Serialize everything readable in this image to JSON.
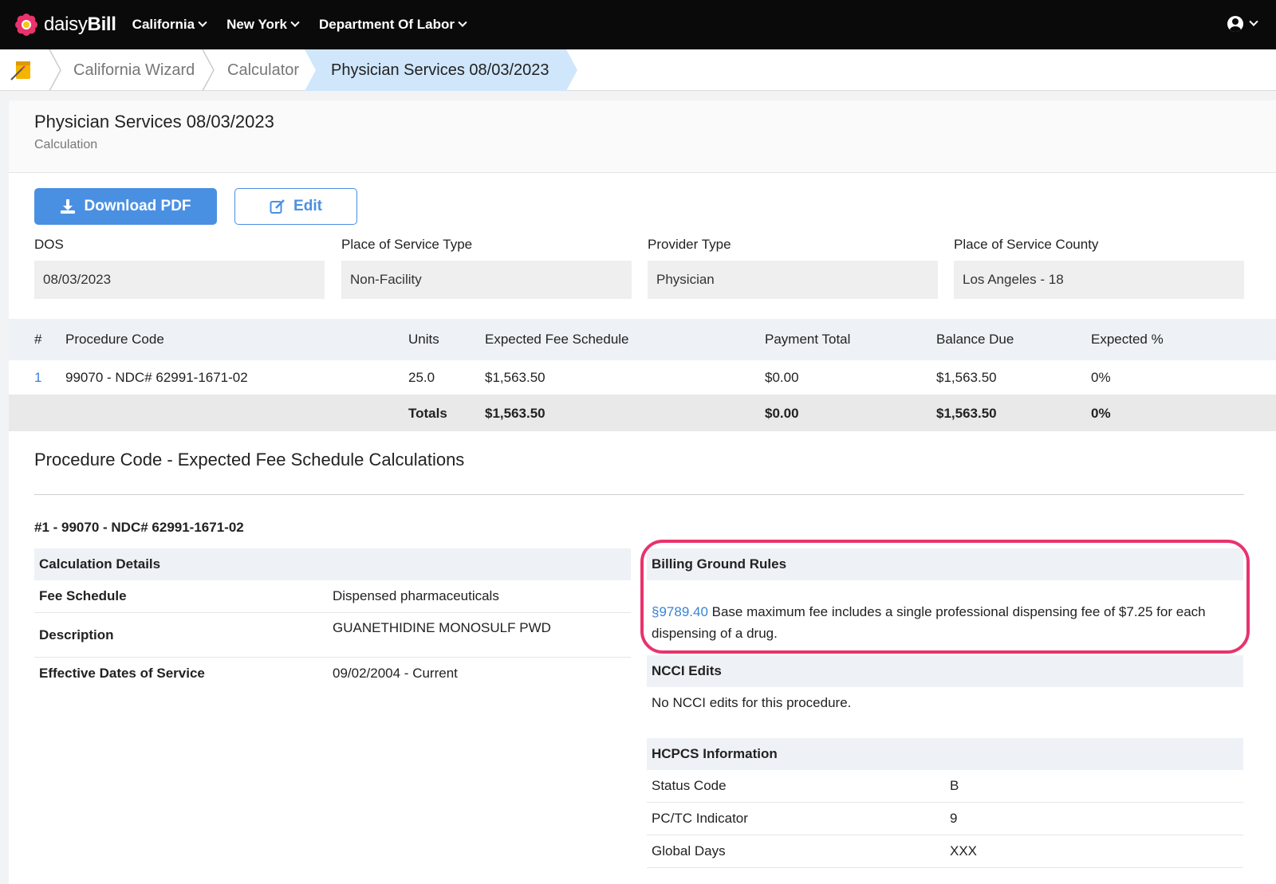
{
  "brand": {
    "name_light": "daisy",
    "name_bold": "Bill",
    "flower_color": "#e8336d"
  },
  "nav": {
    "items": [
      "California",
      "New York",
      "Department Of Labor"
    ]
  },
  "breadcrumb": {
    "items": [
      "California Wizard",
      "Calculator"
    ],
    "active": "Physician Services 08/03/2023"
  },
  "header": {
    "title": "Physician Services 08/03/2023",
    "subtitle": "Calculation"
  },
  "actions": {
    "download_label": "Download PDF",
    "edit_label": "Edit",
    "accent": "#4a90e2"
  },
  "fields": [
    {
      "label": "DOS",
      "value": "08/03/2023"
    },
    {
      "label": "Place of Service Type",
      "value": "Non-Facility"
    },
    {
      "label": "Provider Type",
      "value": "Physician"
    },
    {
      "label": "Place of Service County",
      "value": "Los Angeles - 18"
    }
  ],
  "table": {
    "headers": [
      "#",
      "Procedure Code",
      "Units",
      "Expected Fee Schedule",
      "Payment Total",
      "Balance Due",
      "Expected %"
    ],
    "rows": [
      {
        "num": "1",
        "code": "99070 - NDC# 62991-1671-02",
        "units": "25.0",
        "expected": "$1,563.50",
        "payment": "$0.00",
        "balance": "$1,563.50",
        "pct": "0%"
      }
    ],
    "totals": {
      "label": "Totals",
      "expected": "$1,563.50",
      "payment": "$0.00",
      "balance": "$1,563.50",
      "pct": "0%"
    }
  },
  "section": {
    "title": "Procedure Code - Expected Fee Schedule Calculations",
    "proc_title": "#1 - 99070 - NDC# 62991-1671-02"
  },
  "calc_details": {
    "title": "Calculation Details",
    "rows": [
      {
        "key": "Fee Schedule",
        "value": "Dispensed pharmaceuticals"
      },
      {
        "key": "Description",
        "value": "GUANETHIDINE MONOSULF PWD"
      },
      {
        "key": "Effective Dates of Service",
        "value": "09/02/2004 - Current"
      }
    ]
  },
  "billing_rules": {
    "title": "Billing Ground Rules",
    "link": "§9789.40",
    "text": " Base maximum fee includes a single professional dispensing fee of $7.25 for each dispensing of a drug.",
    "highlight_color": "#e8336d"
  },
  "ncci": {
    "title": "NCCI Edits",
    "text": "No NCCI edits for this procedure."
  },
  "hcpcs": {
    "title": "HCPCS Information",
    "rows": [
      {
        "key": "Status Code",
        "value": "B"
      },
      {
        "key": "PC/TC Indicator",
        "value": "9"
      },
      {
        "key": "Global Days",
        "value": "XXX"
      }
    ]
  }
}
